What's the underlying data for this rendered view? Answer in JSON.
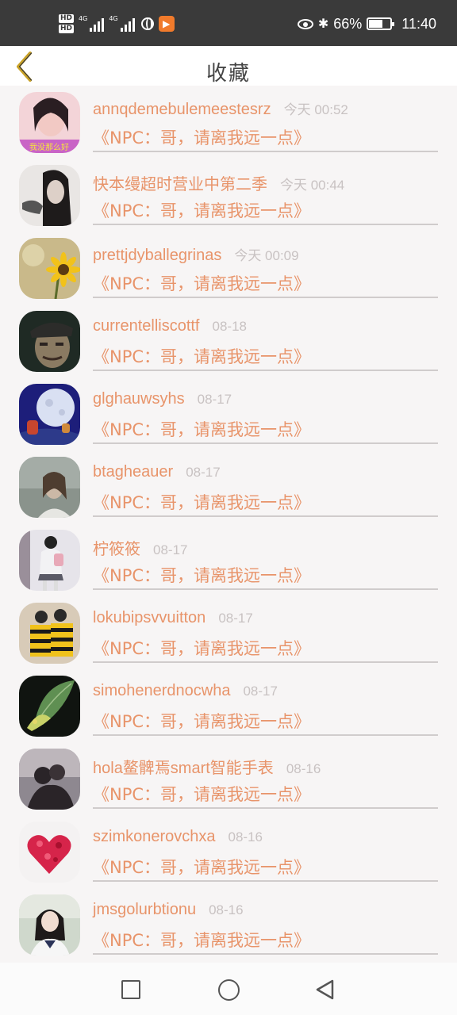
{
  "status_bar": {
    "hd1": "HD",
    "hd2": "HD",
    "sig1_label": "4G",
    "sig2_label": "4G",
    "app_badge": "▶",
    "battery_pct": "66%",
    "battery_level": 0.66,
    "time": "11:40"
  },
  "header": {
    "title": "收藏"
  },
  "items": [
    {
      "name": "annqdemebulemeestesrz",
      "time": "今天 00:52",
      "subtitle": "《NPC：哥，请离我远一点》"
    },
    {
      "name": "快本缦超时营业中第二季",
      "time": "今天 00:44",
      "subtitle": "《NPC：哥，请离我远一点》"
    },
    {
      "name": "prettjdyballegrinas",
      "time": "今天 00:09",
      "subtitle": "《NPC：哥，请离我远一点》"
    },
    {
      "name": "currentelliscottf",
      "time": "08-18",
      "subtitle": "《NPC：哥，请离我远一点》"
    },
    {
      "name": "glghauwsyhs",
      "time": "08-17",
      "subtitle": "《NPC：哥，请离我远一点》"
    },
    {
      "name": "btagheauer",
      "time": "08-17",
      "subtitle": "《NPC：哥，请离我远一点》"
    },
    {
      "name": "柠筱筱",
      "time": "08-17",
      "subtitle": "《NPC：哥，请离我远一点》"
    },
    {
      "name": "lokubipsvvuitton",
      "time": "08-17",
      "subtitle": "《NPC：哥，请离我远一点》"
    },
    {
      "name": "simohenerdnocwha",
      "time": "08-17",
      "subtitle": "《NPC：哥，请离我远一点》"
    },
    {
      "name": "hola鳌髀焉smart智能手表",
      "time": "08-16",
      "subtitle": "《NPC：哥，请离我远一点》"
    },
    {
      "name": "szimkonerovchxa",
      "time": "08-16",
      "subtitle": "《NPC：哥，请离我远一点》"
    },
    {
      "name": "jmsgolurbtionu",
      "time": "08-16",
      "subtitle": "《NPC：哥，请离我远一点》"
    }
  ],
  "avatar_overlay_text": "我没那么好",
  "colors": {
    "accent": "#e8946a",
    "time": "#c8c2c2",
    "back_icon": "#c9a227"
  }
}
